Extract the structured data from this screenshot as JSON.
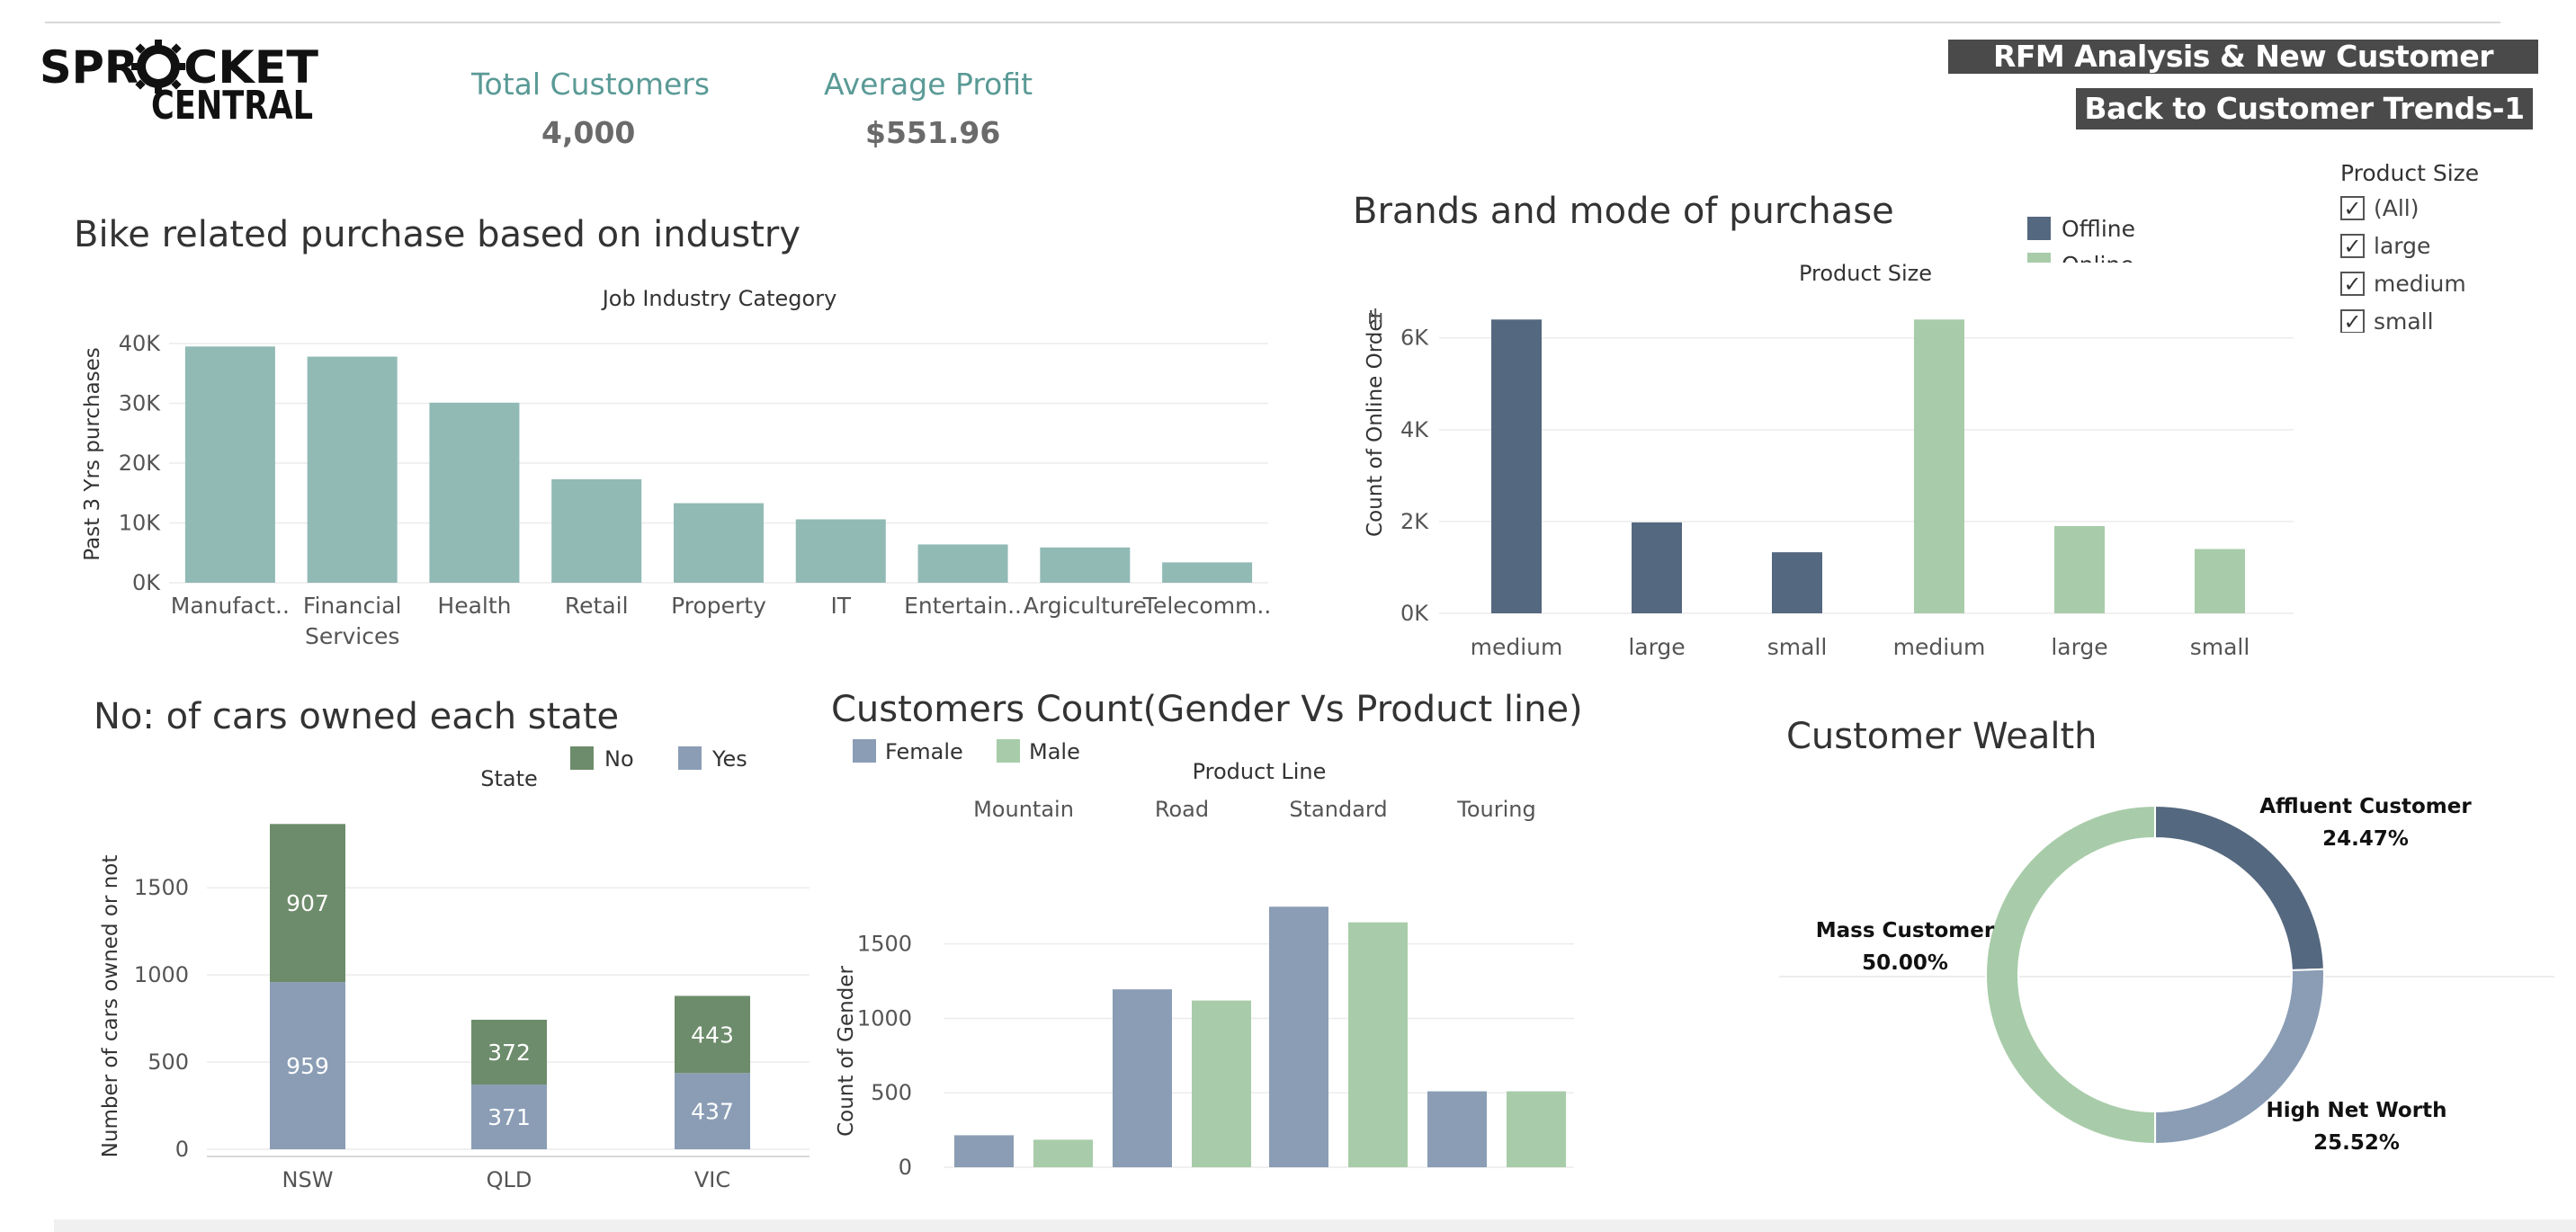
{
  "header": {
    "logo_text_line1": "SPROCKET",
    "logo_text_line2": "CENTRAL",
    "kpis": [
      {
        "label": "Total Customers",
        "value": "4,000"
      },
      {
        "label": "Average Profit",
        "value": "$551.96"
      }
    ],
    "buttons": {
      "rfm": "RFM Analysis & New Customer Trends",
      "back": "Back to Customer Trends-1"
    }
  },
  "product_size_filter": {
    "title": "Product Size",
    "options": [
      {
        "label": "(All)",
        "checked": true
      },
      {
        "label": "large",
        "checked": true
      },
      {
        "label": "medium",
        "checked": true
      },
      {
        "label": "small",
        "checked": true
      }
    ]
  },
  "colors": {
    "teal": "#91bab5",
    "offline": "#54687f",
    "online": "#a8cca9",
    "no": "#6d8c6b",
    "yes": "#8a9db5",
    "female": "#8a9db5",
    "male": "#a8cca9",
    "affluent": "#54687f",
    "high_net_worth": "#8a9db5",
    "mass": "#a8cca9"
  },
  "chart_data": [
    {
      "id": "industry",
      "type": "bar",
      "title": "Bike related purchase based on industry",
      "header": "Job Industry Category",
      "ylabel": "Past 3 Yrs purchases",
      "categories": [
        [
          "Manufact.."
        ],
        [
          "Financial",
          "Services"
        ],
        [
          "Health"
        ],
        [
          "Retail"
        ],
        [
          "Property"
        ],
        [
          "IT"
        ],
        [
          "Entertain.."
        ],
        [
          "Argiculture"
        ],
        [
          "Telecomm.."
        ]
      ],
      "values": [
        39500,
        37800,
        30100,
        17300,
        13300,
        10600,
        6400,
        5900,
        3400
      ],
      "ylim": [
        0,
        43000
      ],
      "yticks": [
        0,
        10000,
        20000,
        30000,
        40000
      ],
      "ytick_labels": [
        "0K",
        "10K",
        "20K",
        "30K",
        "40K"
      ]
    },
    {
      "id": "brands",
      "type": "bar",
      "title": "Brands and mode of purchase",
      "header": "Product Size",
      "ylabel": "Count of Online Order",
      "legend": [
        "Offline",
        "Online"
      ],
      "categories": [
        "medium",
        "large",
        "small",
        "medium",
        "large",
        "small"
      ],
      "series_of_bar": [
        "Offline",
        "Offline",
        "Offline",
        "Online",
        "Online",
        "Online"
      ],
      "values": [
        6400,
        1980,
        1330,
        6400,
        1900,
        1400
      ],
      "ylim": [
        0,
        6700
      ],
      "yticks": [
        0,
        2000,
        4000,
        6000
      ],
      "ytick_labels": [
        "0K",
        "2K",
        "4K",
        "6K"
      ]
    },
    {
      "id": "cars",
      "type": "bar",
      "stacked": true,
      "title": "No: of cars owned each state",
      "header": "State",
      "ylabel": "Number of cars owned or not",
      "legend": [
        "No",
        "Yes"
      ],
      "categories": [
        "NSW",
        "QLD",
        "VIC"
      ],
      "series": [
        {
          "name": "Yes",
          "values": [
            959,
            371,
            437
          ]
        },
        {
          "name": "No",
          "values": [
            907,
            372,
            443
          ]
        }
      ],
      "ylim": [
        0,
        1950
      ],
      "yticks": [
        0,
        500,
        1000,
        1500
      ]
    },
    {
      "id": "gender",
      "type": "bar",
      "title": "Customers Count(Gender Vs Product line)",
      "header": "Product Line",
      "ylabel": "Count of Gender",
      "legend": [
        "Female",
        "Male"
      ],
      "groups": [
        "Mountain",
        "Road",
        "Standard",
        "Touring"
      ],
      "series": [
        {
          "name": "Female",
          "values": [
            215,
            1195,
            1750,
            510
          ]
        },
        {
          "name": "Male",
          "values": [
            185,
            1120,
            1645,
            510
          ]
        }
      ],
      "ylim": [
        0,
        1800
      ],
      "yticks": [
        0,
        500,
        1000,
        1500
      ]
    },
    {
      "id": "wealth",
      "type": "pie",
      "donut": true,
      "title": "Customer Wealth",
      "slices": [
        {
          "label": "Affluent Customer",
          "value": 24.47,
          "pct": "24.47%"
        },
        {
          "label": "High Net Worth",
          "value": 25.52,
          "pct": "25.52%"
        },
        {
          "label": "Mass Customer",
          "value": 50.0,
          "pct": "50.00%"
        }
      ]
    }
  ]
}
